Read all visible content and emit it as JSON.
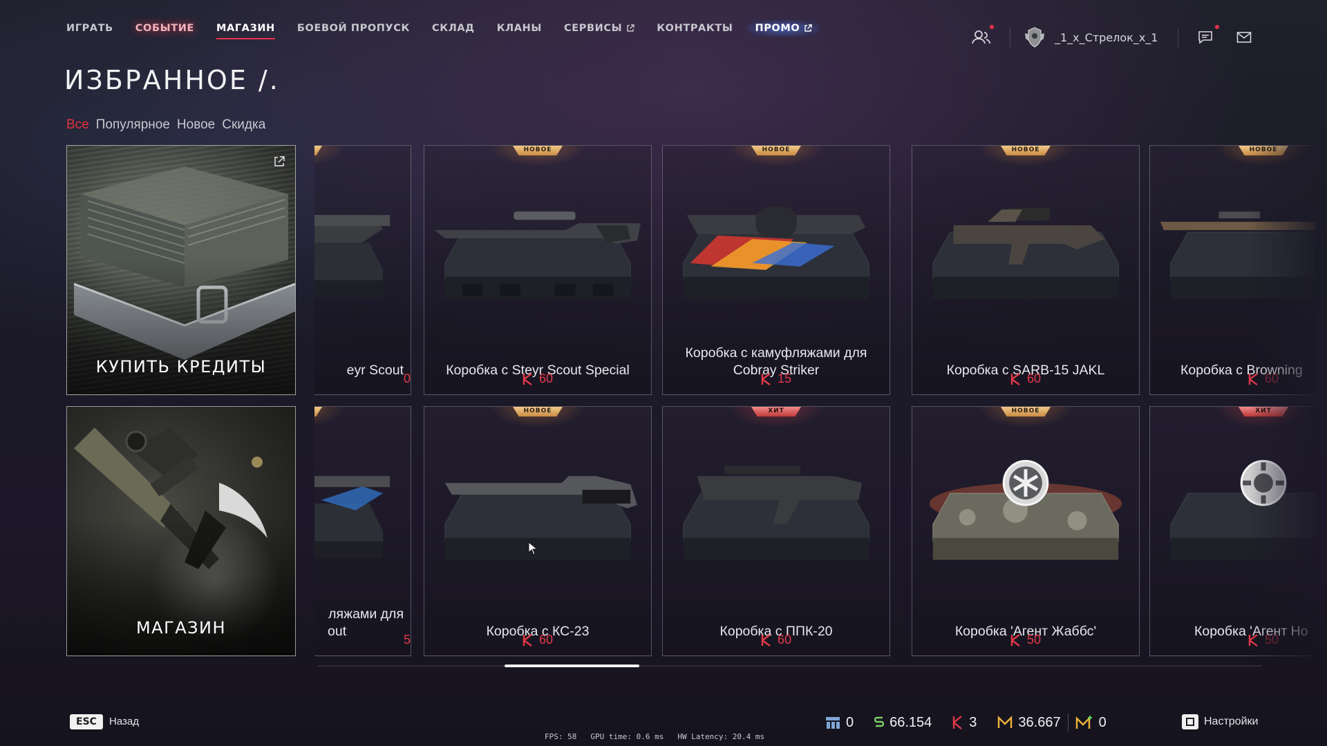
{
  "nav": {
    "items": [
      {
        "label": "ИГРАТЬ"
      },
      {
        "label": "СОБЫТИЕ"
      },
      {
        "label": "МАГАЗИН"
      },
      {
        "label": "БОЕВОЙ ПРОПУСК"
      },
      {
        "label": "СКЛАД"
      },
      {
        "label": "КЛАНЫ"
      },
      {
        "label": "СЕРВИСЫ"
      },
      {
        "label": "КОНТРАКТЫ"
      },
      {
        "label": "ПРОМО"
      }
    ],
    "active_index": 2
  },
  "user": {
    "name": "_1_x_Стрелок_x_1"
  },
  "page": {
    "title": "ИЗБРАННОЕ /."
  },
  "filters": [
    {
      "label": "Все",
      "active": true
    },
    {
      "label": "Популярное",
      "active": false
    },
    {
      "label": "Новое",
      "active": false
    },
    {
      "label": "Скидка",
      "active": false
    }
  ],
  "promos": {
    "credits_label": "КУПИТЬ КРЕДИТЫ",
    "shop_label": "МАГАЗИН"
  },
  "partial_left": {
    "top": {
      "name_fragment": "eyr Scout",
      "price_fragment": "0"
    },
    "bottom": {
      "name_fragment_1": "ляжами для",
      "name_fragment_2": "out",
      "price_fragment": "5"
    }
  },
  "cards": {
    "r1c1": {
      "badge": "НОВОЕ",
      "name": "Коробка с Steyr Scout Special",
      "price": "60"
    },
    "r1c2": {
      "badge": "НОВОЕ",
      "name": "Коробка с камуфляжами для Cobray Striker",
      "price": "15"
    },
    "r1c3": {
      "badge": "НОВОЕ",
      "name": "Коробка с SARB-15 JAKL",
      "price": "60"
    },
    "r1c4": {
      "badge": "НОВОЕ",
      "name": "Коробка с Browning",
      "price": "60"
    },
    "r2c1": {
      "badge": "НОВОЕ",
      "name": "Коробка с КС-23",
      "price": "60"
    },
    "r2c2": {
      "badge": "ХИТ",
      "name": "Коробка с ППК-20",
      "price": "60"
    },
    "r2c3": {
      "badge": "НОВОЕ",
      "name": "Коробка 'Агент Жаббс'",
      "price": "50"
    },
    "r2c4": {
      "badge": "ХИТ",
      "name": "Коробка 'Агент Ho",
      "price": "50"
    }
  },
  "bottom": {
    "esc_key": "ESC",
    "back_label": "Назад",
    "stats": {
      "fps": "FPS: 58",
      "gpu": "GPU time: 0.6 ms",
      "latency": "HW Latency: 20.4 ms"
    },
    "currencies": {
      "tokens": "0",
      "dollars": "66.154",
      "k": "3",
      "crowns": "36.667",
      "bonus_crowns": "0"
    },
    "settings_label": "Настройки"
  },
  "colors": {
    "accent_red": "#e33947",
    "badge_new": "#e0a25a",
    "badge_hit": "#d94a4a"
  },
  "icons": [
    "friends-icon",
    "rank-icon",
    "chat-icon",
    "mail-icon",
    "external-link-icon",
    "k-currency-icon",
    "dollar-icon",
    "crown-icon",
    "settings-key-icon"
  ]
}
